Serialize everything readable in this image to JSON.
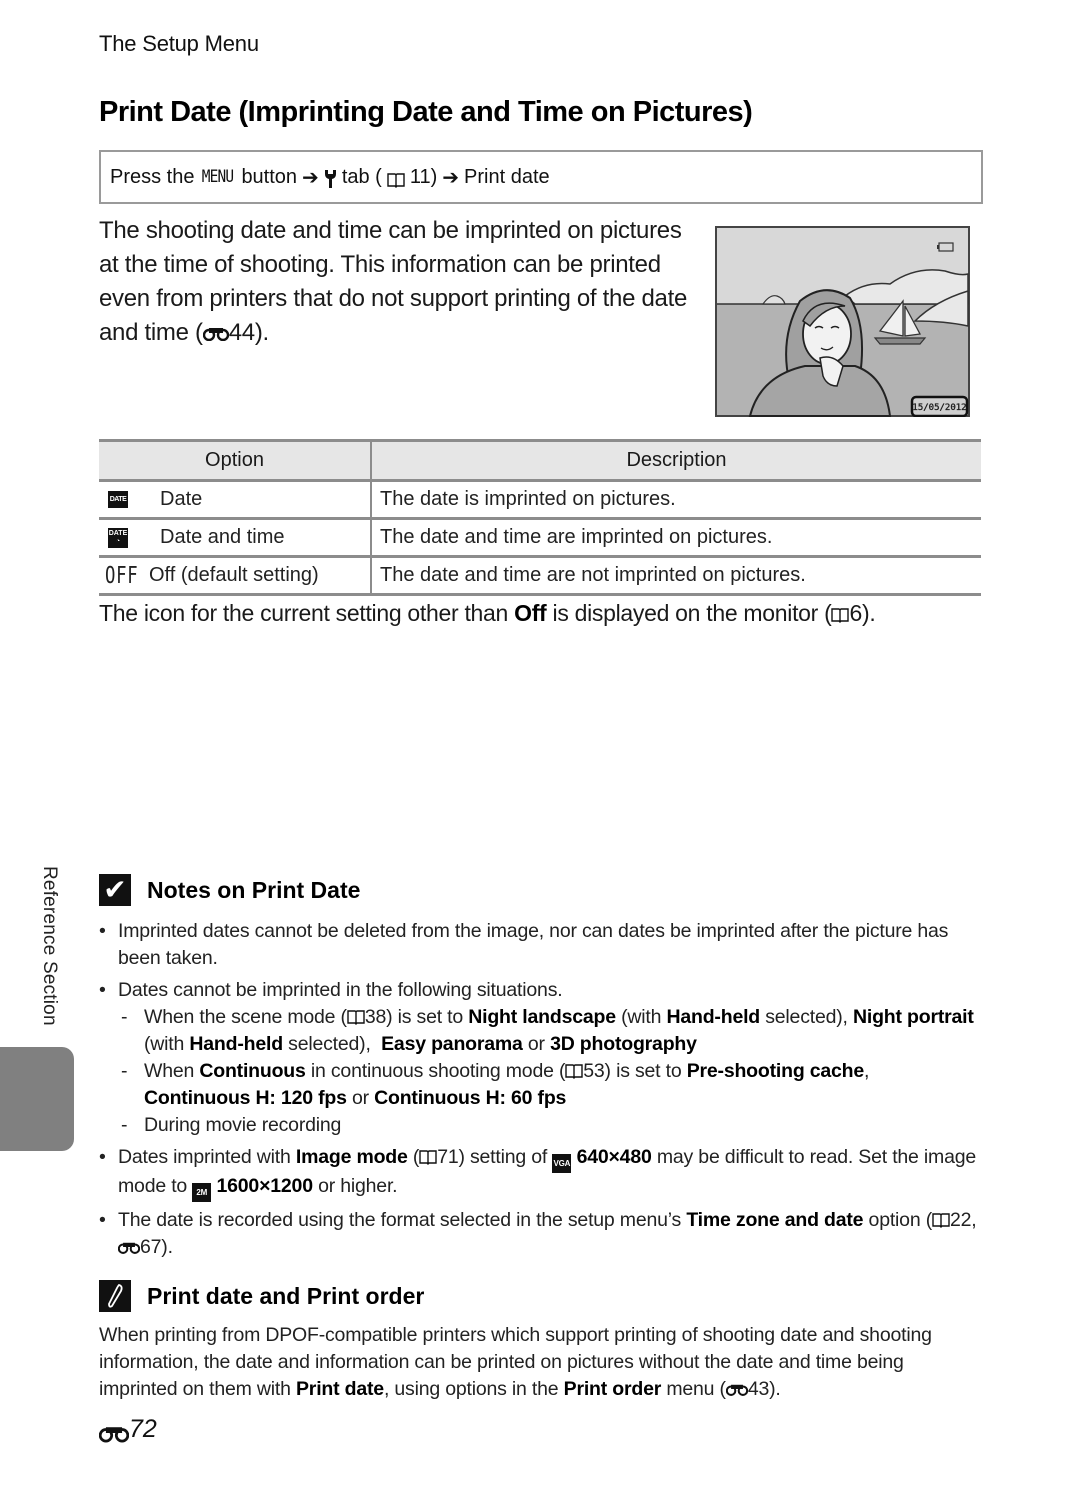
{
  "header": {
    "section": "The Setup Menu",
    "title": "Print Date (Imprinting Date and Time on Pictures)"
  },
  "nav_path": {
    "press": "Press the",
    "menu_glyph": "MENU",
    "button": "button",
    "tab_label": "tab (",
    "tab_page": "11)",
    "destination": "Print date",
    "icons": [
      "arrow-right-icon",
      "wrench-icon",
      "book-icon",
      "arrow-right-icon"
    ]
  },
  "intro": {
    "text": "The shooting date and time can be imprinted on pictures at the time of shooting. This information can be printed even from printers that do not support printing of the date and time (",
    "ref": "44).",
    "ref_icon": "binoculars-icon"
  },
  "illustration": {
    "description": "Camera monitor showing woman portrait with sailboat and mountains",
    "date_stamp": "15/05/2012",
    "battery_icon": "battery-icon"
  },
  "table": {
    "headers": [
      "Option",
      "Description"
    ],
    "rows": [
      {
        "icon": "date-icon",
        "icon_text": "DATE",
        "option": "Date",
        "description": "The date is imprinted on pictures."
      },
      {
        "icon": "date-time-icon",
        "icon_text": "DATE",
        "option": "Date and time",
        "description": "The date and time are imprinted on pictures."
      },
      {
        "icon": "off-icon",
        "icon_text": "OFF",
        "option": "Off (default setting)",
        "description": "The date and time are not imprinted on pictures."
      }
    ]
  },
  "after_table": {
    "pre": "The icon for the current setting other than ",
    "bold": "Off",
    "post": " is displayed on the monitor (",
    "ref": "6)."
  },
  "side_label": "Reference Section",
  "notes": {
    "title": "Notes on Print Date",
    "b1": "Imprinted dates cannot be deleted from the image, nor can dates be imprinted after the picture has been taken.",
    "b2": "Dates cannot be imprinted in the following situations.",
    "d1": {
      "t1": "When the scene mode (",
      "ref": "38) is set to ",
      "b1": "Night landscape",
      "t2": " (with ",
      "b2": "Hand-held",
      "t3": " selected), ",
      "b3": "Night portrait",
      "t4": " (with ",
      "b4": "Hand-held",
      "t5": " selected),  ",
      "b5": "Easy panorama",
      "t6": " or ",
      "b6": "3D photography"
    },
    "d2": {
      "t1": "When ",
      "b1": "Continuous",
      "t2": " in continuous shooting mode (",
      "ref": "53) is set to ",
      "b2": "Pre-shooting cache",
      "t3": ", ",
      "b3": "Continuous H: 120 fps",
      "t4": " or ",
      "b4": "Continuous H: 60 fps"
    },
    "d3": "During movie recording",
    "b3": {
      "t1": "Dates imprinted with ",
      "b1": "Image mode",
      "t2": " (",
      "ref": "71) setting of ",
      "icon1": "VGA",
      "b2": "640×480",
      "t3": " may be difficult to read. Set the image mode to ",
      "icon2": "2M",
      "b3": "1600×1200",
      "t4": " or higher."
    },
    "b4": {
      "t1": "The date is recorded using the format selected in the setup menu’s ",
      "b1": "Time zone and date",
      "t2": " option (",
      "ref1": "22, ",
      "ref2": "67)."
    }
  },
  "print_order": {
    "title": "Print date and Print order",
    "t1": "When printing from DPOF-compatible printers which support printing of shooting date and shooting information, the date and information can be printed on pictures without the date and time being imprinted on them with ",
    "b1": "Print date",
    "t2": ", using options in the ",
    "b2": "Print order",
    "t3": " menu (",
    "ref": "43)."
  },
  "page_number": "72"
}
